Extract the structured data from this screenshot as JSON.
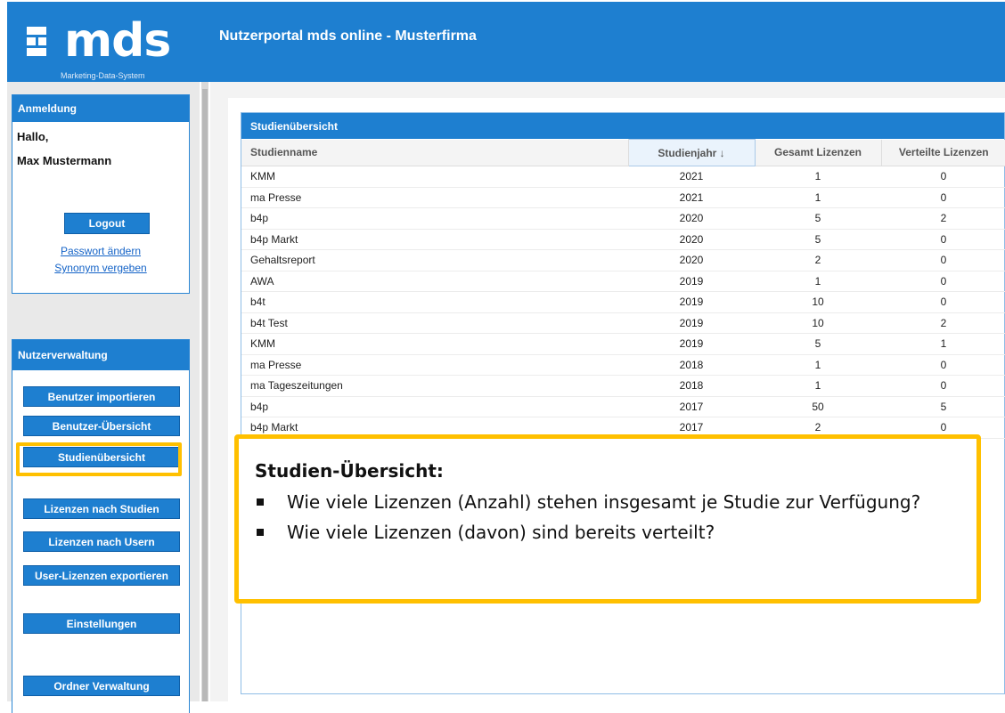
{
  "header": {
    "logo_text": "mds",
    "logo_sub": "Marketing-Data-System",
    "title": "Nutzerportal mds online - Musterfirma",
    "bg_color": "#1e7fd0"
  },
  "login_panel": {
    "title": "Anmeldung",
    "greeting": "Hallo,",
    "user_name": "Max Mustermann",
    "logout_label": "Logout",
    "change_password": "Passwort ändern",
    "assign_synonym": "Synonym vergeben"
  },
  "admin_panel": {
    "title": "Nutzerverwaltung",
    "buttons": [
      "Benutzer importieren",
      "Benutzer-Übersicht",
      "Studienübersicht",
      "Lizenzen nach Studien",
      "Lizenzen nach Usern",
      "User-Lizenzen exportieren",
      "Einstellungen",
      "Ordner Verwaltung"
    ]
  },
  "study_overview": {
    "title": "Studienübersicht",
    "columns": [
      "Studienname",
      "Studienjahr ↓",
      "Gesamt Lizenzen",
      "Verteilte Lizenzen"
    ],
    "rows": [
      [
        "KMM",
        "2021",
        "1",
        "0"
      ],
      [
        "ma Presse",
        "2021",
        "1",
        "0"
      ],
      [
        "b4p",
        "2020",
        "5",
        "2"
      ],
      [
        "b4p Markt",
        "2020",
        "5",
        "0"
      ],
      [
        "Gehaltsreport",
        "2020",
        "2",
        "0"
      ],
      [
        "AWA",
        "2019",
        "1",
        "0"
      ],
      [
        "b4t",
        "2019",
        "10",
        "0"
      ],
      [
        "b4t Test",
        "2019",
        "10",
        "2"
      ],
      [
        "KMM",
        "2019",
        "5",
        "1"
      ],
      [
        "ma Presse",
        "2018",
        "1",
        "0"
      ],
      [
        "ma Tageszeitungen",
        "2018",
        "1",
        "0"
      ],
      [
        "b4p",
        "2017",
        "50",
        "5"
      ],
      [
        "b4p Markt",
        "2017",
        "2",
        "0"
      ]
    ]
  },
  "callout": {
    "title": "Studien-Übersicht:",
    "bullets": [
      "Wie viele Lizenzen (Anzahl) stehen insgesamt je Studie zur Verfügung?",
      "Wie viele Lizenzen (davon) sind bereits verteilt?"
    ],
    "border_color": "#ffc000"
  }
}
